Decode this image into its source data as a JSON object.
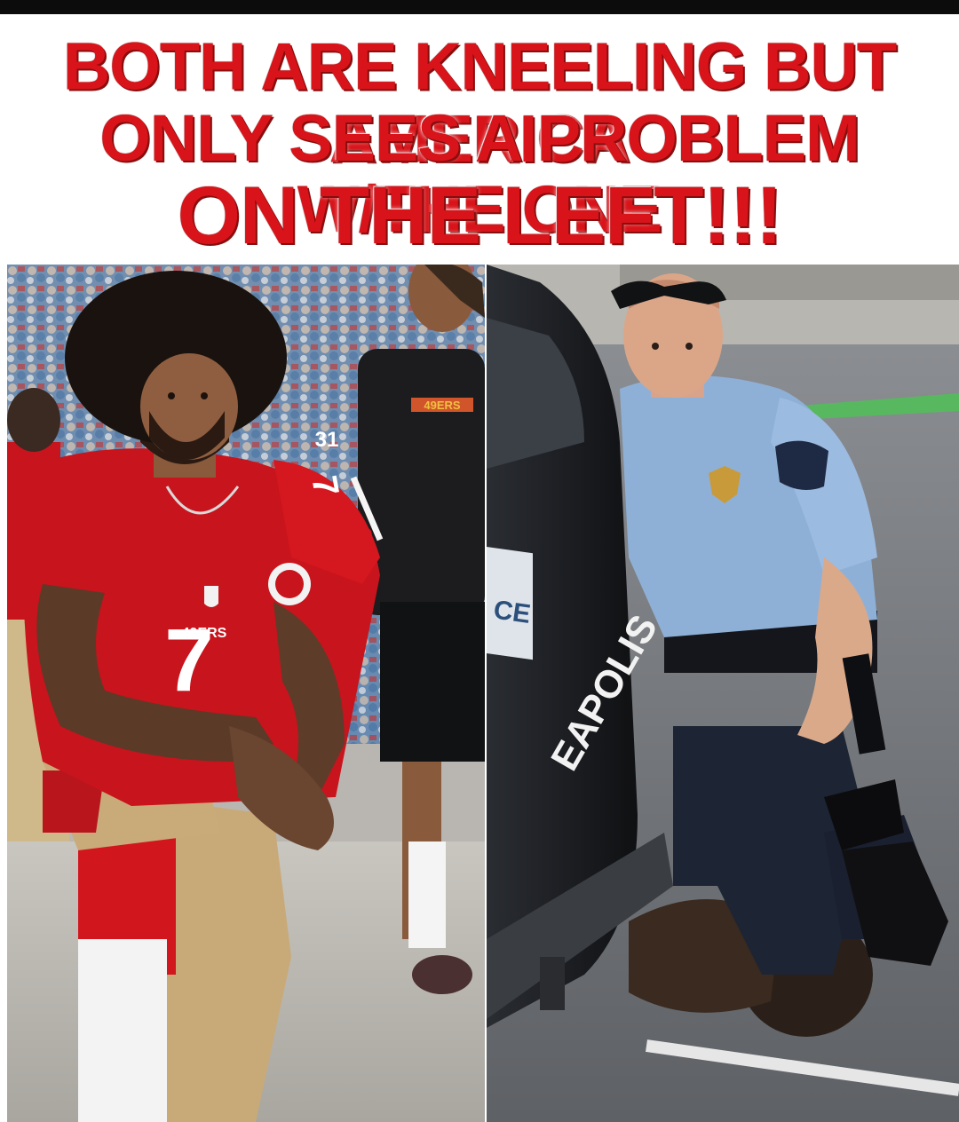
{
  "headline": {
    "line1": "BOTH ARE KNEELING BUT AMERICA",
    "line2": "ONLY SEES A PROBLEM W/THE ONE",
    "line3": "ON THE LEFT!!!"
  },
  "left_photo": {
    "jersey_number": "7",
    "jersey_script": "49ERS",
    "shirt_logo": "49ERS",
    "crowd_number": "31"
  },
  "right_photo": {
    "vehicle_text": "EAPOLIS",
    "plate_text": "CE"
  },
  "colors": {
    "headline_red": "#d8141a",
    "jersey_red": "#c8141c",
    "uniform_blue": "#8fb0d6",
    "vehicle_dark": "#1e2024"
  }
}
